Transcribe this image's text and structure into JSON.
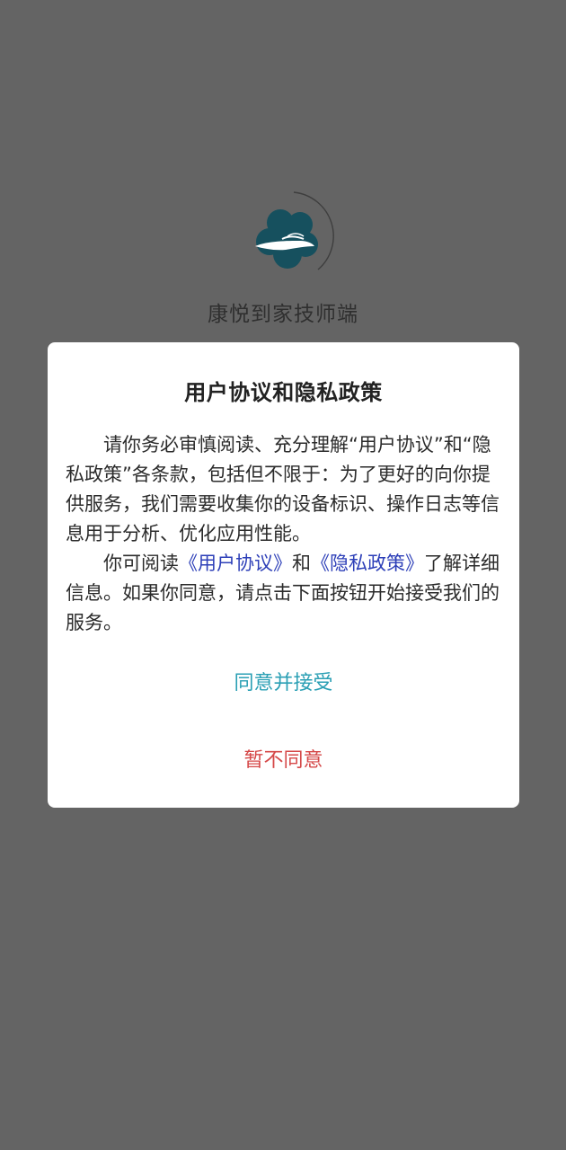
{
  "app": {
    "name": "康悦到家技师端",
    "logo_icon": "cloud-hand-logo-icon",
    "colors": {
      "logo": "#16505e",
      "overlay": "#646464"
    }
  },
  "dialog": {
    "title": "用户协议和隐私政策",
    "paragraph1": "请你务必审慎阅读、充分理解“用户协议”和“隐私政策”各条款，包括但不限于：为了更好的向你提供服务，我们需要收集你的设备标识、操作日志等信息用于分析、优化应用性能。",
    "paragraph2": {
      "prefix": "你可阅读",
      "user_agreement_link": "《用户协议》",
      "middle": "和",
      "privacy_policy_link": "《隐私政策》",
      "suffix": "了解详细信息。如果你同意，请点击下面按钮开始接受我们的服务。"
    },
    "accept_button": "同意并接受",
    "decline_button": "暂不同意",
    "colors": {
      "link": "#2d3fb8",
      "accept": "#2a9fb4",
      "decline": "#d54848"
    }
  }
}
